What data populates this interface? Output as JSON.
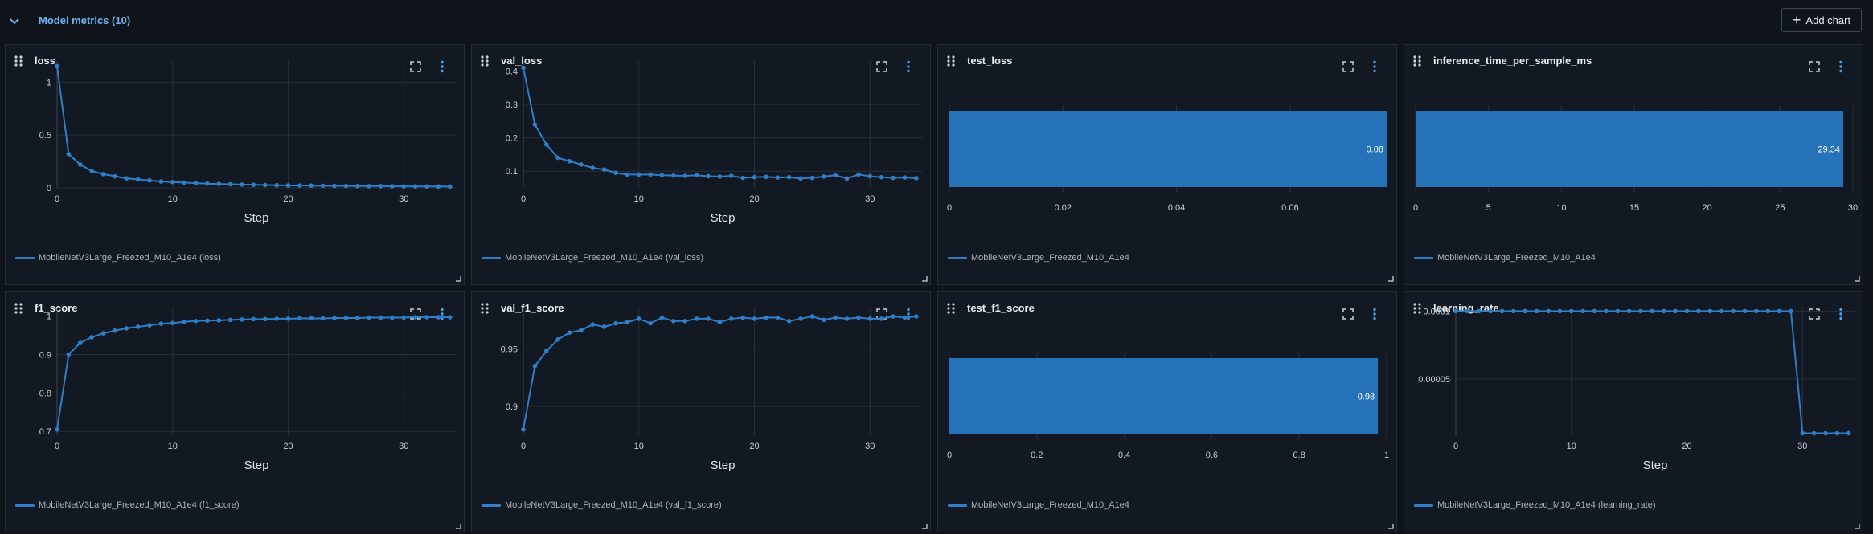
{
  "section": {
    "title": "Model metrics (10)",
    "add_chart_label": "Add chart"
  },
  "colors": {
    "accent": "#2f7ec8",
    "bar": "#2672b8",
    "background": "#0f141b",
    "panel": "#121922"
  },
  "icons": {
    "collapse": "chevron-down-icon",
    "drag": "drag-handle-icon",
    "expand": "expand-icon",
    "more": "more-vertical-icon",
    "add": "plus-icon"
  },
  "panels": [
    {
      "title": "loss",
      "legend": "MobileNetV3Large_Freezed_M10_A1e4 (loss)"
    },
    {
      "title": "val_loss",
      "legend": "MobileNetV3Large_Freezed_M10_A1e4 (val_loss)"
    },
    {
      "title": "test_loss",
      "legend": "MobileNetV3Large_Freezed_M10_A1e4"
    },
    {
      "title": "inference_time_per_sample_ms",
      "legend": "MobileNetV3Large_Freezed_M10_A1e4"
    },
    {
      "title": "f1_score",
      "legend": "MobileNetV3Large_Freezed_M10_A1e4 (f1_score)"
    },
    {
      "title": "val_f1_score",
      "legend": "MobileNetV3Large_Freezed_M10_A1e4 (val_f1_score)"
    },
    {
      "title": "test_f1_score",
      "legend": "MobileNetV3Large_Freezed_M10_A1e4"
    },
    {
      "title": "learning_rate",
      "legend": "MobileNetV3Large_Freezed_M10_A1e4 (learning_rate)"
    }
  ],
  "chart_data": [
    {
      "type": "line",
      "title": "loss",
      "xlabel": "Step",
      "ylabel": "",
      "xlim": [
        0,
        34.5
      ],
      "ylim": [
        0,
        1.2
      ],
      "xticks": [
        0,
        10,
        20,
        30
      ],
      "yticks": [
        0,
        0.5,
        1
      ],
      "ytick_labels": [
        "0",
        "0.5",
        "1"
      ],
      "series": [
        {
          "name": "MobileNetV3Large_Freezed_M10_A1e4 (loss)",
          "x": [
            0,
            1,
            2,
            3,
            4,
            5,
            6,
            7,
            8,
            9,
            10,
            11,
            12,
            13,
            14,
            15,
            16,
            17,
            18,
            19,
            20,
            21,
            22,
            23,
            24,
            25,
            26,
            27,
            28,
            29,
            30,
            31,
            32,
            33,
            34
          ],
          "y": [
            1.15,
            0.32,
            0.22,
            0.16,
            0.13,
            0.11,
            0.09,
            0.08,
            0.07,
            0.06,
            0.055,
            0.05,
            0.045,
            0.04,
            0.037,
            0.034,
            0.031,
            0.029,
            0.027,
            0.025,
            0.023,
            0.022,
            0.021,
            0.02,
            0.019,
            0.018,
            0.017,
            0.016,
            0.016,
            0.015,
            0.014,
            0.014,
            0.013,
            0.013,
            0.012
          ]
        }
      ]
    },
    {
      "type": "line",
      "title": "val_loss",
      "xlabel": "Step",
      "ylabel": "",
      "xlim": [
        0,
        34.5
      ],
      "ylim": [
        0.05,
        0.43
      ],
      "xticks": [
        0,
        10,
        20,
        30
      ],
      "yticks": [
        0.1,
        0.2,
        0.3,
        0.4
      ],
      "ytick_labels": [
        "0.1",
        "0.2",
        "0.3",
        "0.4"
      ],
      "series": [
        {
          "name": "MobileNetV3Large_Freezed_M10_A1e4 (val_loss)",
          "x": [
            0,
            1,
            2,
            3,
            4,
            5,
            6,
            7,
            8,
            9,
            10,
            11,
            12,
            13,
            14,
            15,
            16,
            17,
            18,
            19,
            20,
            21,
            22,
            23,
            24,
            25,
            26,
            27,
            28,
            29,
            30,
            31,
            32,
            33,
            34
          ],
          "y": [
            0.41,
            0.24,
            0.18,
            0.14,
            0.13,
            0.12,
            0.11,
            0.105,
            0.095,
            0.09,
            0.09,
            0.09,
            0.088,
            0.087,
            0.086,
            0.088,
            0.085,
            0.084,
            0.086,
            0.08,
            0.082,
            0.083,
            0.081,
            0.082,
            0.078,
            0.08,
            0.084,
            0.088,
            0.078,
            0.09,
            0.085,
            0.082,
            0.08,
            0.081,
            0.079
          ]
        }
      ]
    },
    {
      "type": "bar",
      "orientation": "horizontal",
      "title": "test_loss",
      "xlim": [
        0,
        0.077
      ],
      "xticks": [
        0,
        0.02,
        0.04,
        0.06
      ],
      "xtick_labels": [
        "0",
        "0.02",
        "0.04",
        "0.06"
      ],
      "series": [
        {
          "name": "MobileNetV3Large_Freezed_M10_A1e4",
          "values": [
            0.077
          ],
          "label": "0.08"
        }
      ]
    },
    {
      "type": "bar",
      "orientation": "horizontal",
      "title": "inference_time_per_sample_ms",
      "xlim": [
        0,
        30
      ],
      "xticks": [
        0,
        5,
        10,
        15,
        20,
        25,
        30
      ],
      "xtick_labels": [
        "0",
        "5",
        "10",
        "15",
        "20",
        "25",
        "30"
      ],
      "series": [
        {
          "name": "MobileNetV3Large_Freezed_M10_A1e4",
          "values": [
            29.34
          ],
          "label": "29.34"
        }
      ]
    },
    {
      "type": "line",
      "title": "f1_score",
      "xlabel": "Step",
      "ylabel": "",
      "xlim": [
        0,
        34.5
      ],
      "ylim": [
        0.69,
        1.02
      ],
      "xticks": [
        0,
        10,
        20,
        30
      ],
      "yticks": [
        0.7,
        0.8,
        0.9,
        1
      ],
      "ytick_labels": [
        "0.7",
        "0.8",
        "0.9",
        "1"
      ],
      "series": [
        {
          "name": "MobileNetV3Large_Freezed_M10_A1e4 (f1_score)",
          "x": [
            0,
            1,
            2,
            3,
            4,
            5,
            6,
            7,
            8,
            9,
            10,
            11,
            12,
            13,
            14,
            15,
            16,
            17,
            18,
            19,
            20,
            21,
            22,
            23,
            24,
            25,
            26,
            27,
            28,
            29,
            30,
            31,
            32,
            33,
            34
          ],
          "y": [
            0.705,
            0.9,
            0.93,
            0.945,
            0.955,
            0.962,
            0.968,
            0.972,
            0.976,
            0.98,
            0.982,
            0.985,
            0.987,
            0.988,
            0.989,
            0.99,
            0.991,
            0.992,
            0.992,
            0.993,
            0.993,
            0.994,
            0.994,
            0.994,
            0.995,
            0.995,
            0.995,
            0.996,
            0.996,
            0.996,
            0.996,
            0.997,
            0.997,
            0.997,
            0.997
          ]
        }
      ]
    },
    {
      "type": "line",
      "title": "val_f1_score",
      "xlabel": "Step",
      "ylabel": "",
      "xlim": [
        0,
        34.5
      ],
      "ylim": [
        0.875,
        0.985
      ],
      "xticks": [
        0,
        10,
        20,
        30
      ],
      "yticks": [
        0.9,
        0.95
      ],
      "ytick_labels": [
        "0.9",
        "0.95"
      ],
      "series": [
        {
          "name": "MobileNetV3Large_Freezed_M10_A1e4 (val_f1_score)",
          "x": [
            0,
            1,
            2,
            3,
            4,
            5,
            6,
            7,
            8,
            9,
            10,
            11,
            12,
            13,
            14,
            15,
            16,
            17,
            18,
            19,
            20,
            21,
            22,
            23,
            24,
            25,
            26,
            27,
            28,
            29,
            30,
            31,
            32,
            33,
            34
          ],
          "y": [
            0.88,
            0.935,
            0.948,
            0.958,
            0.964,
            0.966,
            0.971,
            0.969,
            0.972,
            0.973,
            0.976,
            0.972,
            0.977,
            0.974,
            0.974,
            0.976,
            0.976,
            0.973,
            0.976,
            0.977,
            0.976,
            0.977,
            0.977,
            0.974,
            0.976,
            0.978,
            0.975,
            0.977,
            0.976,
            0.977,
            0.976,
            0.976,
            0.978,
            0.977,
            0.978
          ]
        }
      ]
    },
    {
      "type": "bar",
      "orientation": "horizontal",
      "title": "test_f1_score",
      "xlim": [
        0,
        1
      ],
      "xticks": [
        0,
        0.2,
        0.4,
        0.6,
        0.8,
        1
      ],
      "xtick_labels": [
        "0",
        "0.2",
        "0.4",
        "0.6",
        "0.8",
        "1"
      ],
      "series": [
        {
          "name": "MobileNetV3Large_Freezed_M10_A1e4",
          "values": [
            0.98
          ],
          "label": "0.98"
        }
      ]
    },
    {
      "type": "line",
      "title": "learning_rate",
      "xlabel": "Step",
      "ylabel": "",
      "xlim": [
        0,
        34.5
      ],
      "ylim": [
        8.5e-06,
        0.000102
      ],
      "xticks": [
        0,
        10,
        20,
        30
      ],
      "yticks": [
        5e-05,
        0.0001
      ],
      "ytick_labels": [
        "0.00005",
        "0.0001"
      ],
      "series": [
        {
          "name": "MobileNetV3Large_Freezed_M10_A1e4 (learning_rate)",
          "x": [
            0,
            1,
            2,
            3,
            4,
            5,
            6,
            7,
            8,
            9,
            10,
            11,
            12,
            13,
            14,
            15,
            16,
            17,
            18,
            19,
            20,
            21,
            22,
            23,
            24,
            25,
            26,
            27,
            28,
            29,
            30,
            31,
            32,
            33,
            34
          ],
          "y": [
            0.0001,
            0.0001,
            0.0001,
            0.0001,
            0.0001,
            0.0001,
            0.0001,
            0.0001,
            0.0001,
            0.0001,
            0.0001,
            0.0001,
            0.0001,
            0.0001,
            0.0001,
            0.0001,
            0.0001,
            0.0001,
            0.0001,
            0.0001,
            0.0001,
            0.0001,
            0.0001,
            0.0001,
            0.0001,
            0.0001,
            0.0001,
            0.0001,
            0.0001,
            0.0001,
            1e-05,
            1e-05,
            1e-05,
            1e-05,
            1e-05
          ]
        }
      ]
    }
  ]
}
